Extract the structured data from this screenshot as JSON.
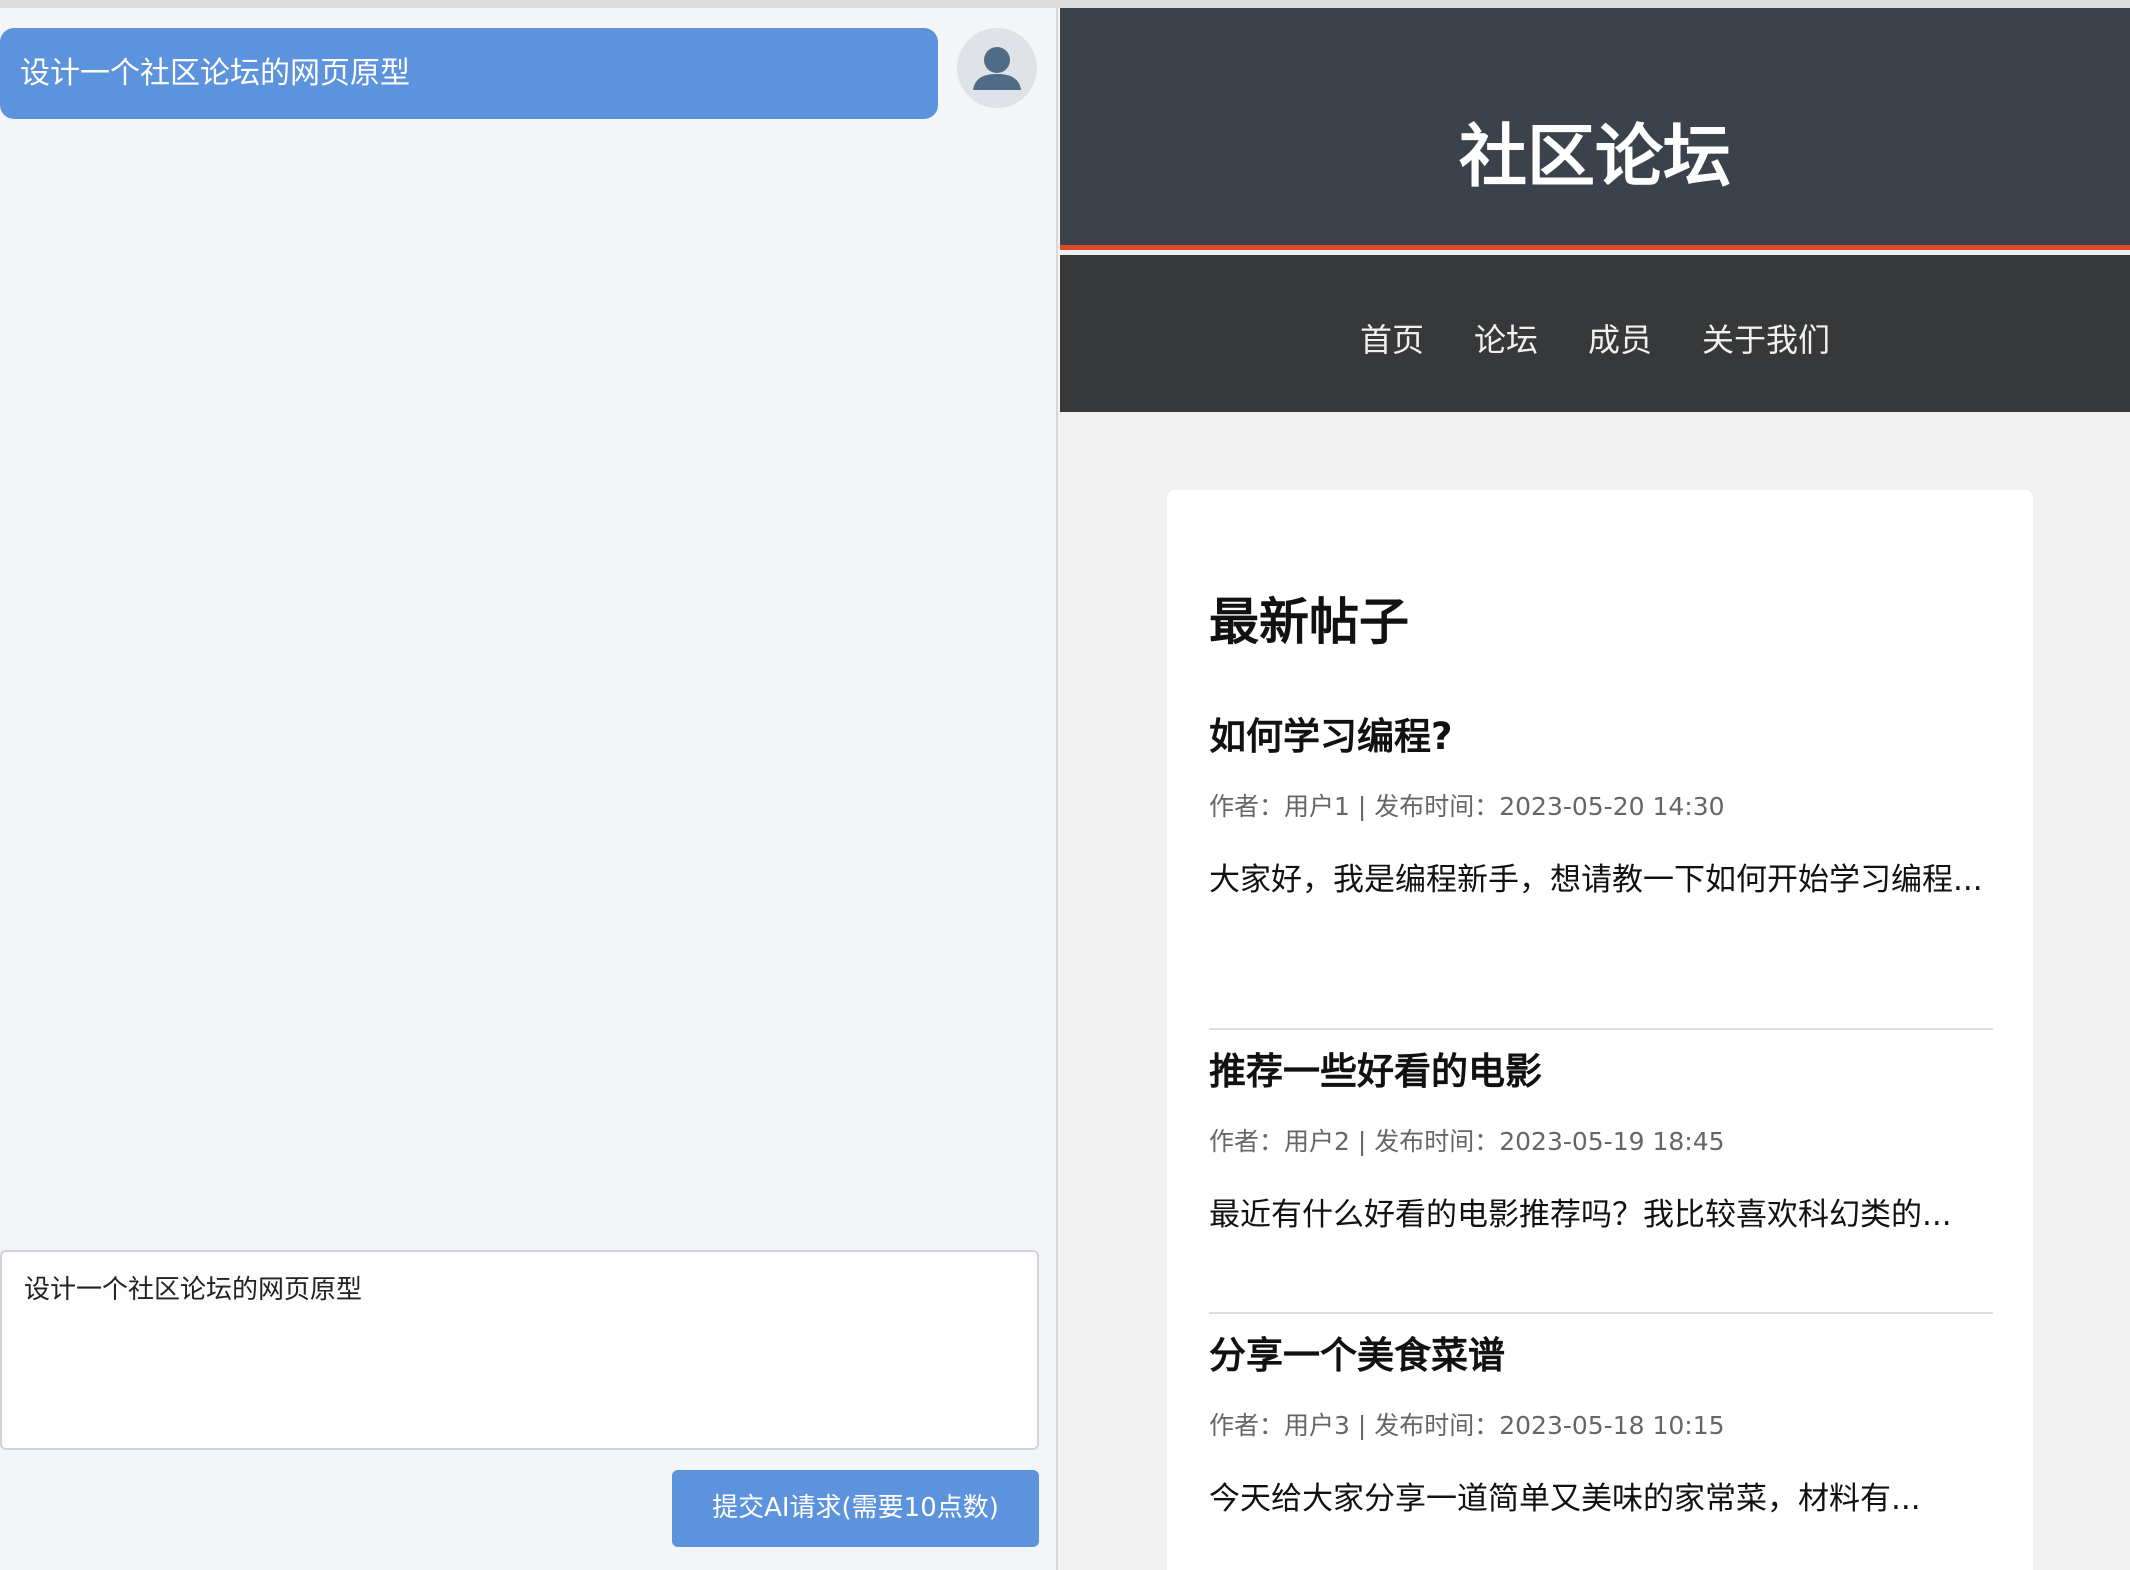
{
  "chat": {
    "user_message": "设计一个社区论坛的网页原型",
    "input_value": "设计一个社区论坛的网页原型",
    "submit_label": "提交AI请求(需要10点数)"
  },
  "site": {
    "title": "社区论坛",
    "nav": [
      "首页",
      "论坛",
      "成员",
      "关于我们"
    ],
    "section_title": "最新帖子",
    "posts": [
      {
        "title": "如何学习编程?",
        "meta": "作者：用户1 | 发布时间：2023-05-20 14:30",
        "excerpt": "大家好，我是编程新手，想请教一下如何开始学习编程..."
      },
      {
        "title": "推荐一些好看的电影",
        "meta": "作者：用户2 | 发布时间：2023-05-19 18:45",
        "excerpt": "最近有什么好看的电影推荐吗？我比较喜欢科幻类的..."
      },
      {
        "title": "分享一个美食菜谱",
        "meta": "作者：用户3 | 发布时间：2023-05-18 10:15",
        "excerpt": "今天给大家分享一道简单又美味的家常菜，材料有..."
      }
    ]
  },
  "colors": {
    "accent_blue": "#5c93dc",
    "header_bg": "#3c424b",
    "header_border": "#e0482a",
    "nav_bg": "#373839"
  },
  "icons": {
    "avatar": "user-silhouette-icon"
  }
}
